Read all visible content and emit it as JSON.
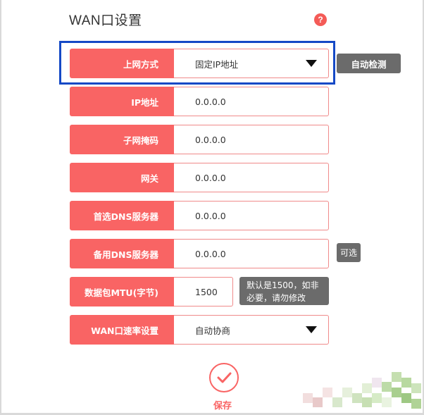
{
  "page": {
    "title": "WAN口设置",
    "help_icon": "?"
  },
  "form": {
    "rows": [
      {
        "key": "connection_type",
        "label": "上网方式",
        "value": "固定IP地址",
        "control": "select"
      },
      {
        "key": "ip_address",
        "label": "IP地址",
        "value": "0.0.0.0",
        "control": "input"
      },
      {
        "key": "subnet_mask",
        "label": "子网掩码",
        "value": "0.0.0.0",
        "control": "input"
      },
      {
        "key": "gateway",
        "label": "网关",
        "value": "0.0.0.0",
        "control": "input"
      },
      {
        "key": "primary_dns",
        "label": "首选DNS服务器",
        "value": "0.0.0.0",
        "control": "input"
      },
      {
        "key": "secondary_dns",
        "label": "备用DNS服务器",
        "value": "0.0.0.0",
        "control": "input"
      },
      {
        "key": "mtu",
        "label": "数据包MTU(字节)",
        "value": "1500",
        "control": "input"
      },
      {
        "key": "wan_speed",
        "label": "WAN口速率设置",
        "value": "自动协商",
        "control": "select"
      }
    ]
  },
  "buttons": {
    "auto_detect": "自动检测",
    "save": "保存"
  },
  "hints": {
    "optional": "可选",
    "mtu_line1": "默认是1500，如非",
    "mtu_line2": "必要，请勿修改"
  },
  "colors": {
    "label_bg": "#f96464",
    "highlight": "#1549c6",
    "hint_bg": "#6b6b6b"
  }
}
